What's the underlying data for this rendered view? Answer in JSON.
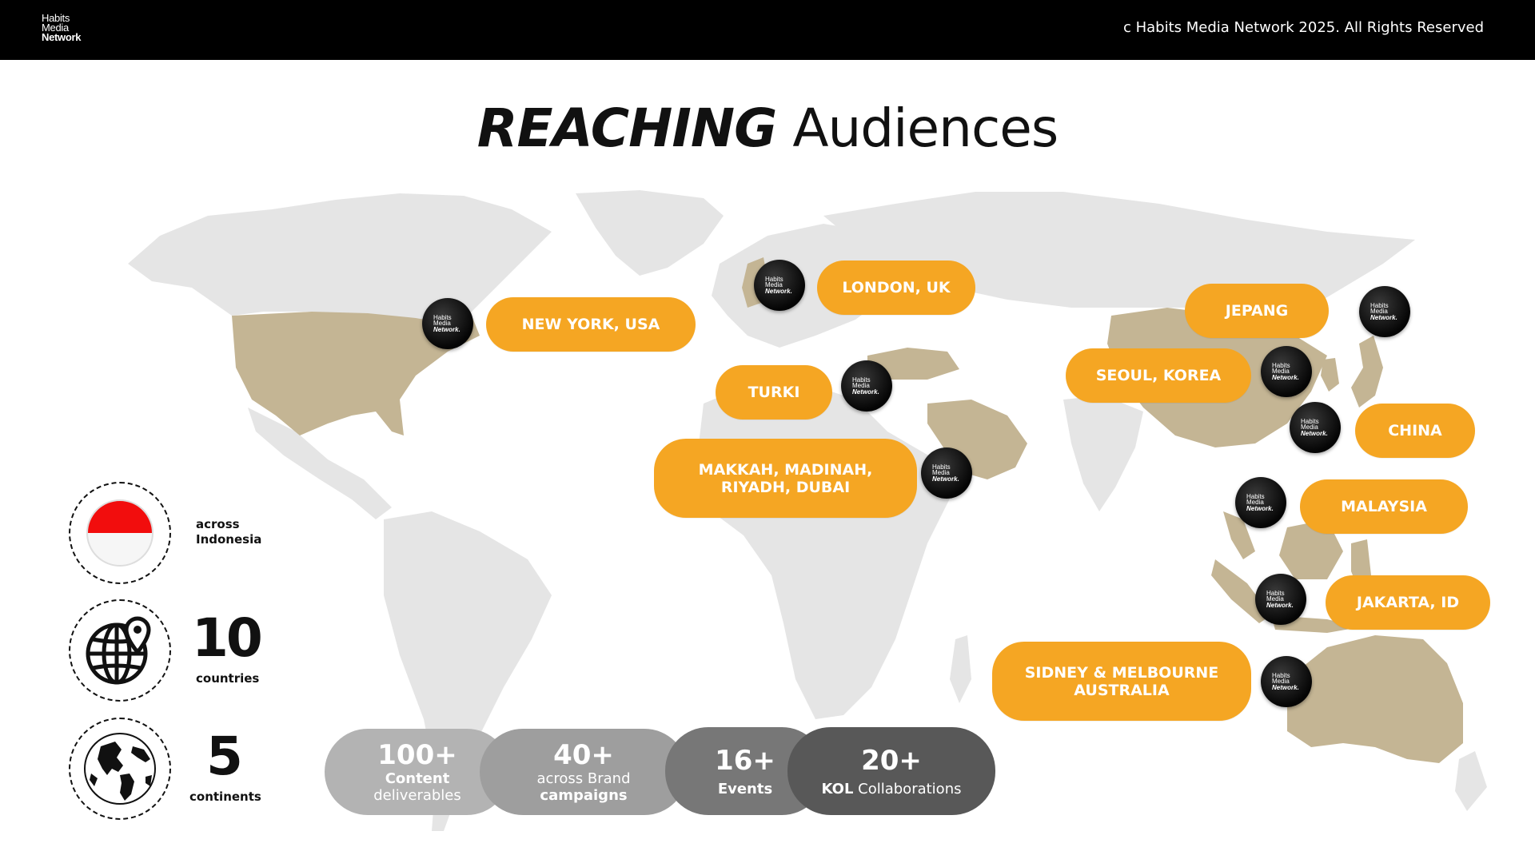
{
  "header": {
    "brand_line1": "Habits",
    "brand_line2": "Media",
    "brand_line3": "Network",
    "copyright": "c Habits Media Network 2025. All Rights Reserved"
  },
  "title": {
    "strong": "REACHING",
    "light": "Audiences"
  },
  "colors": {
    "accent": "#f5a623",
    "highlight_land": "#c4b594",
    "land": "#e5e5e5",
    "header_bg": "#000000"
  },
  "badge": {
    "line1": "Habits",
    "line2": "Media",
    "line3": "Network."
  },
  "locations": [
    {
      "label": "NEW YORK, USA"
    },
    {
      "label": "LONDON, UK"
    },
    {
      "label": "TURKI"
    },
    {
      "label": "MAKKAH, MADINAH, RIYADH, DUBAI"
    },
    {
      "label": "JEPANG"
    },
    {
      "label": "SEOUL, KOREA"
    },
    {
      "label": "CHINA"
    },
    {
      "label": "MALAYSIA"
    },
    {
      "label": "JAKARTA, ID"
    },
    {
      "label": "SIDNEY & MELBOURNE AUSTRALIA"
    }
  ],
  "stats": {
    "indonesia": {
      "text_line1": "across",
      "text_line2": "Indonesia",
      "icon": "indonesia-flag-icon"
    },
    "countries": {
      "value": "10",
      "label": "countries",
      "icon": "globe-pin-icon"
    },
    "continents": {
      "value": "5",
      "label": "continents",
      "icon": "earth-icon"
    }
  },
  "metrics": [
    {
      "value": "100+",
      "line1": "Content",
      "line2": "deliverables"
    },
    {
      "value": "40+",
      "line1": "across Brand",
      "line2": "campaigns"
    },
    {
      "value": "16+",
      "line1": "Events"
    },
    {
      "value": "20+",
      "line1_bold": "KOL",
      "line1_rest": " Collaborations"
    }
  ]
}
